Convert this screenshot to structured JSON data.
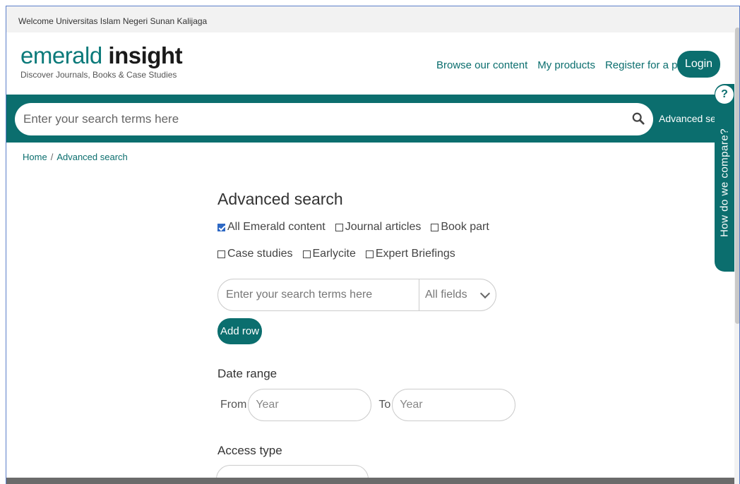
{
  "welcome": "Welcome Universitas Islam Negeri Sunan Kalijaga",
  "logo": {
    "light": "emerald",
    "bold": "insight",
    "tagline": "Discover Journals, Books & Case Studies"
  },
  "nav": {
    "browse": "Browse our content",
    "products": "My products",
    "register": "Register for a profile",
    "login": "Login"
  },
  "search": {
    "placeholder": "Enter your search terms here",
    "advanced_link": "Advanced search"
  },
  "breadcrumb": {
    "home": "Home",
    "sep": "/",
    "current": "Advanced search"
  },
  "side_tab": {
    "icon": "question-icon",
    "label": "How do we compare?"
  },
  "advanced": {
    "title": "Advanced search",
    "types": [
      {
        "label": "All Emerald content",
        "checked": true
      },
      {
        "label": "Journal articles",
        "checked": false
      },
      {
        "label": "Book part",
        "checked": false
      },
      {
        "label": "Case studies",
        "checked": false
      },
      {
        "label": "Earlycite",
        "checked": false
      },
      {
        "label": "Expert Briefings",
        "checked": false
      }
    ],
    "query_placeholder": "Enter your search terms here",
    "field_select": "All fields",
    "add_row": "Add row",
    "date_range_label": "Date range",
    "from_label": "From",
    "to_label": "To",
    "year_placeholder": "Year",
    "access_type_label": "Access type"
  },
  "colors": {
    "brand": "#0b6e6e",
    "checkbox": "#2d68c4"
  }
}
